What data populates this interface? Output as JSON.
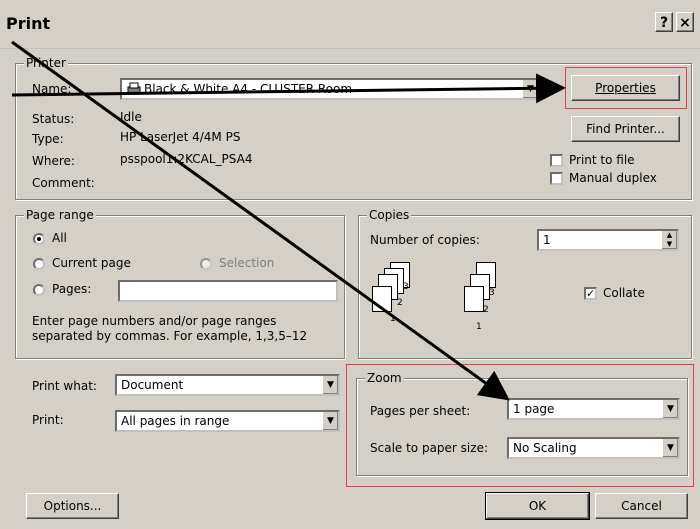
{
  "title": "Print",
  "titlebar": {
    "help_label": "?",
    "close_label": "×"
  },
  "printer": {
    "legend": "Printer",
    "name_label": "Name:",
    "name_value": "Black & White A4 - CLUSTER Room",
    "status_label": "Status:",
    "status_value": "Idle",
    "type_label": "Type:",
    "type_value": "HP LaserJet 4/4M PS",
    "where_label": "Where:",
    "where_value": "psspool1:2KCAL_PSA4",
    "comment_label": "Comment:",
    "properties_label": "Properties",
    "find_printer_label": "Find Printer...",
    "print_to_file_label": "Print to file",
    "manual_duplex_label": "Manual duplex"
  },
  "page_range": {
    "legend": "Page range",
    "all_label": "All",
    "current_label": "Current page",
    "selection_label": "Selection",
    "pages_label": "Pages:",
    "hint": "Enter page numbers and/or page ranges separated by commas.  For example, 1,3,5–12"
  },
  "copies": {
    "legend": "Copies",
    "number_label": "Number of copies:",
    "number_value": "1",
    "collate_label": "Collate",
    "collate_checked": true,
    "stack_a": [
      "1",
      "2",
      "3"
    ],
    "stack_b": [
      "1",
      "2",
      "3"
    ]
  },
  "print_what": {
    "label": "Print what:",
    "value": "Document"
  },
  "print": {
    "label": "Print:",
    "value": "All pages in range"
  },
  "zoom": {
    "legend": "Zoom",
    "pages_per_sheet_label": "Pages per sheet:",
    "pages_per_sheet_value": "1 page",
    "scale_label": "Scale to paper size:",
    "scale_value": "No Scaling"
  },
  "footer": {
    "options_label": "Options...",
    "ok_label": "OK",
    "cancel_label": "Cancel"
  },
  "colors": {
    "highlight": "#e0404f",
    "dialog_bg": "#d4d0c8"
  }
}
